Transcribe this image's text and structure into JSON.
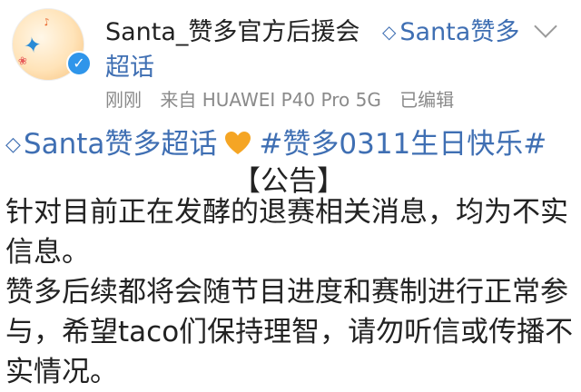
{
  "post": {
    "author_name": "Santa_赞多官方后援会",
    "supertopic_label": "Santa赞多",
    "supertopic_label_line2": "超话",
    "meta": {
      "time": "刚刚",
      "source": "来自 HUAWEI P40 Pro 5G",
      "edited": "已编辑"
    },
    "topic_link": "Santa赞多超话",
    "hashtag": "#赞多0311生日快乐#",
    "notice_title": "【公告】",
    "paragraph1": "针对目前正在发酵的退赛相关消息，均为不实信息。",
    "paragraph2": " 赞多后续都将会随节目进度和赛制进行正常参与，希望taco们保持理智，请勿听信或传播不实情况。"
  },
  "icons": {
    "supertopic": "diamond-icon",
    "verified": "verified-v-icon",
    "menu": "chevron-down-icon",
    "heart": "orange-heart-emoji"
  },
  "colors": {
    "link": "#3f6fb3",
    "text": "#222222",
    "meta": "#8a8a8a",
    "heart": "#f5a524",
    "verified": "#2f95ea"
  }
}
